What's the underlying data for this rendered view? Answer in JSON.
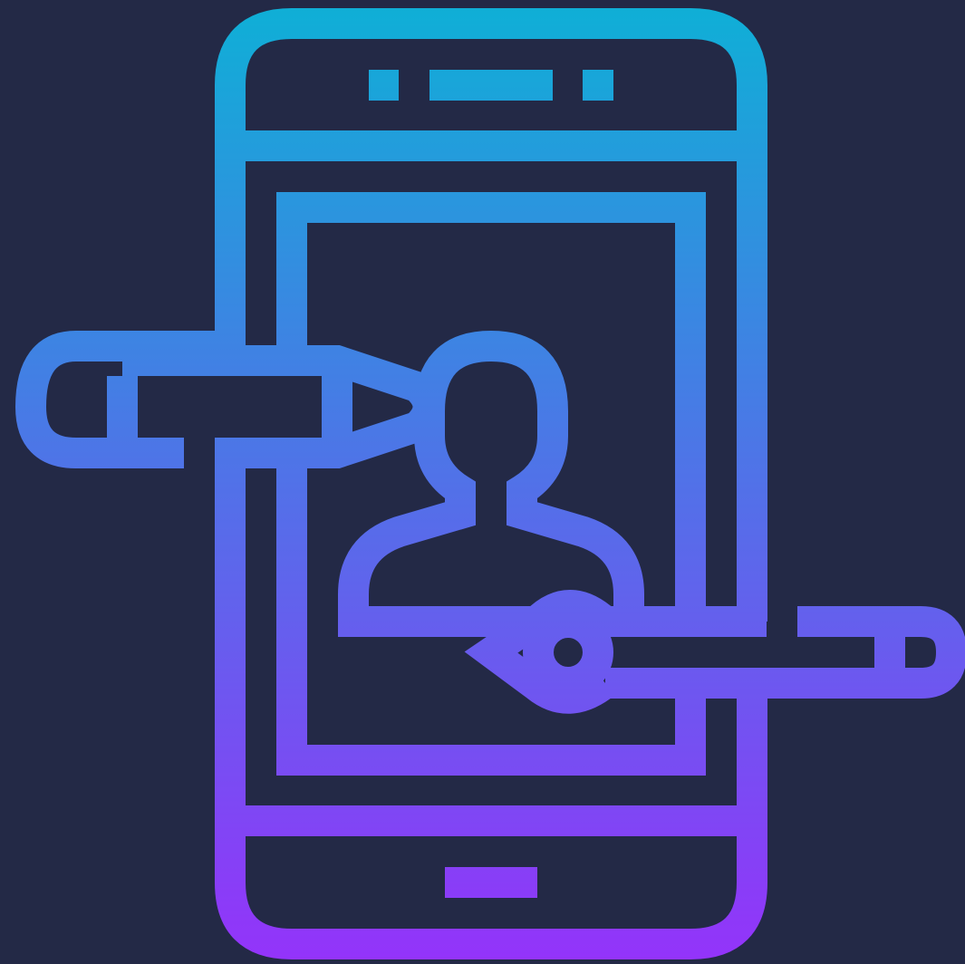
{
  "icon": {
    "name": "mobile-profile-editing-icon",
    "background_color": "#232946",
    "gradient_top": "#0EB0D6",
    "gradient_bottom": "#9433FA"
  }
}
